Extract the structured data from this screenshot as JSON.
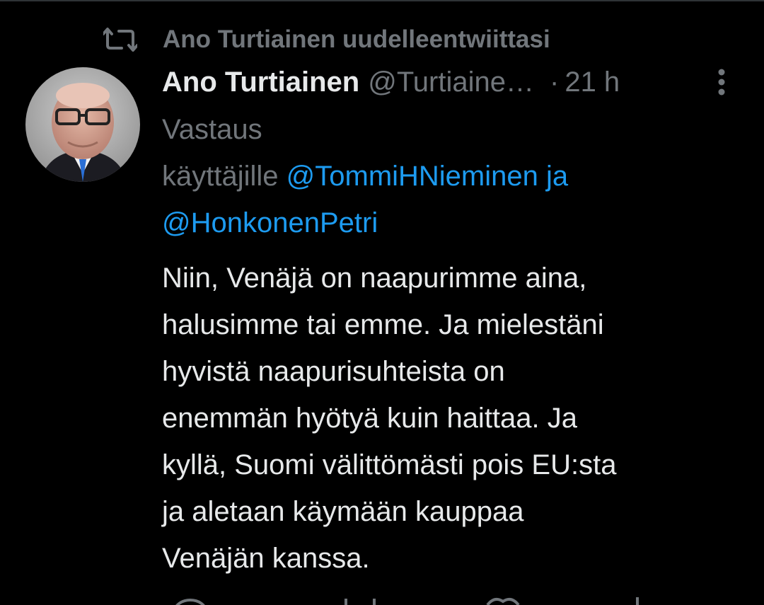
{
  "retweet": {
    "icon": "retweet-icon",
    "text": "Ano Turtiainen uudelleentwiittasi"
  },
  "tweet": {
    "author_name": "Ano Turtiainen",
    "author_handle": "@Turtiaine…",
    "dot": "·",
    "time": "21 h",
    "reply_label_line1": "Vastaus",
    "reply_label_line2": "käyttäjille",
    "mention_1": "@TommiHNieminen",
    "mention_joiner": "ja",
    "mention_2": "@HonkonenPetri",
    "body_lines": [
      "Niin, Venäjä on naapurimme aina,",
      "halusimme tai emme. Ja mielestäni",
      "hyvistä naapurisuhteista on",
      "enemmän hyötyä kuin haittaa. Ja",
      "kyllä, Suomi välittömästi pois EU:sta",
      "ja aletaan käymään kauppaa",
      "Venäjän kanssa."
    ]
  },
  "colors": {
    "background": "#000000",
    "primary_text": "#e7e9ea",
    "secondary_text": "#71767b",
    "link": "#1d9bf0"
  },
  "icons": [
    "retweet-icon",
    "more-options-icon",
    "avatar"
  ]
}
